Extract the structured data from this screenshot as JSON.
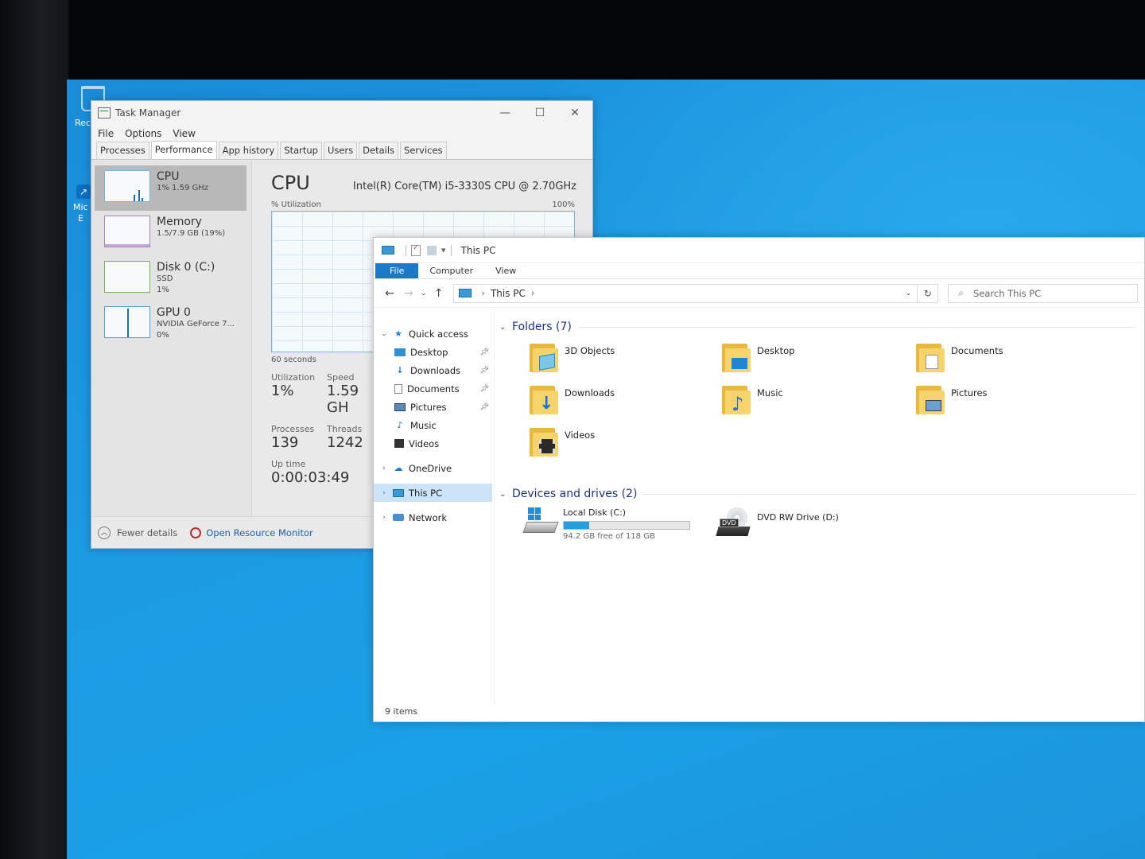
{
  "desktop": {
    "recycle_label": "Recy",
    "edge_label_1": "Mic",
    "edge_label_2": "E"
  },
  "task_manager": {
    "title": "Task Manager",
    "menu": [
      "File",
      "Options",
      "View"
    ],
    "tabs": [
      "Processes",
      "Performance",
      "App history",
      "Startup",
      "Users",
      "Details",
      "Services"
    ],
    "active_tab": "Performance",
    "resources": [
      {
        "name": "CPU",
        "sub1": "1% 1.59 GHz",
        "sub2": ""
      },
      {
        "name": "Memory",
        "sub1": "1.5/7.9 GB (19%)",
        "sub2": ""
      },
      {
        "name": "Disk 0 (C:)",
        "sub1": "SSD",
        "sub2": "1%"
      },
      {
        "name": "GPU 0",
        "sub1": "NVIDIA GeForce 7...",
        "sub2": "0%"
      }
    ],
    "cpu": {
      "heading": "CPU",
      "model": "Intel(R) Core(TM) i5-3330S CPU @ 2.70GHz",
      "util_label": "% Utilization",
      "util_max": "100%",
      "seconds": "60 seconds",
      "utilization_label": "Utilization",
      "utilization": "1%",
      "speed_label": "Speed",
      "speed": "1.59 GH",
      "processes_label": "Processes",
      "processes": "139",
      "threads_label": "Threads",
      "threads": "1242",
      "uptime_label": "Up time",
      "uptime": "0:00:03:49"
    },
    "footer": {
      "fewer": "Fewer details",
      "monitor": "Open Resource Monitor"
    }
  },
  "explorer": {
    "title": "This PC",
    "ribbon": [
      "File",
      "Computer",
      "View"
    ],
    "address": "This PC",
    "search_placeholder": "Search This PC",
    "nav": {
      "quick_access": "Quick access",
      "desktop": "Desktop",
      "downloads": "Downloads",
      "documents": "Documents",
      "pictures": "Pictures",
      "music": "Music",
      "videos": "Videos",
      "onedrive": "OneDrive",
      "this_pc": "This PC",
      "network": "Network"
    },
    "folders_header": "Folders (7)",
    "folders": [
      "3D Objects",
      "Desktop",
      "Documents",
      "Downloads",
      "Music",
      "Pictures",
      "Videos"
    ],
    "devices_header": "Devices and drives (2)",
    "drives": {
      "c_name": "Local Disk (C:)",
      "c_free": "94.2 GB free of 118 GB",
      "c_used_fraction": 0.2,
      "d_name": "DVD RW Drive (D:)",
      "dvd_tag": "DVD"
    },
    "status": "9 items"
  }
}
